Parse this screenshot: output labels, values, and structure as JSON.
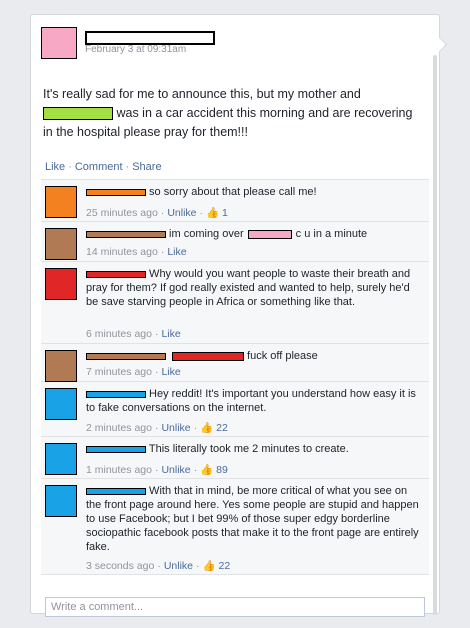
{
  "post": {
    "timestamp": "February 3 at 09:31am",
    "text_part1": "It's really sad for me to announce this, but my mother and",
    "text_part2": " was in a car accident this morning and are recovering in the hospital please pray for them!!!",
    "actions": {
      "like": "Like",
      "comment": "Comment",
      "share": "Share"
    },
    "avatar_color": "#f7a8c4",
    "redact_color": "#a4e043"
  },
  "comments": [
    {
      "name_color": "#f4811f",
      "avatar_color": "#f4811f",
      "text": "so sorry about that please call me!",
      "time": "25 minutes ago",
      "like": "Unlike",
      "likes": "1"
    },
    {
      "name_color": "#b07b54",
      "avatar_color": "#b07b54",
      "text": "im coming over",
      "text_after": "c u in a minute",
      "mid_color": "#f7a8c4",
      "time": "14 minutes ago",
      "like": "Like",
      "likes": ""
    },
    {
      "name_color": "#e02626",
      "avatar_color": "#e02626",
      "text": "Why would you want people to waste their breath and pray for them? If god really existed and wanted to help, surely he'd be save starving people in Africa or something like that.",
      "time": "6 minutes ago",
      "like": "Like",
      "likes": ""
    },
    {
      "name_color": "#b07b54",
      "avatar_color": "#b07b54",
      "mid_color": "#e02626",
      "text": "fuck off please",
      "time": "7 minutes ago",
      "like": "Like",
      "likes": ""
    },
    {
      "name_color": "#1aa2e6",
      "avatar_color": "#1aa2e6",
      "text": "Hey reddit! It's important you understand how easy it is to fake conversations on the internet.",
      "time": "2 minutes ago",
      "like": "Unlike",
      "likes": "22"
    },
    {
      "name_color": "#1aa2e6",
      "avatar_color": "#1aa2e6",
      "text": "This literally took me 2 minutes to create.",
      "time": "1 minutes ago",
      "like": "Unlike",
      "likes": "89"
    },
    {
      "name_color": "#1aa2e6",
      "avatar_color": "#1aa2e6",
      "text": "With that in mind, be more critical of what you see on the front page around here. Yes some people are stupid and happen to use Facebook; but I bet 99% of those super edgy borderline sociopathic facebook posts that make it to the front page are entirely fake.",
      "time": "3 seconds ago",
      "like": "Unlike",
      "likes": "22"
    }
  ],
  "write_placeholder": "Write a comment..."
}
